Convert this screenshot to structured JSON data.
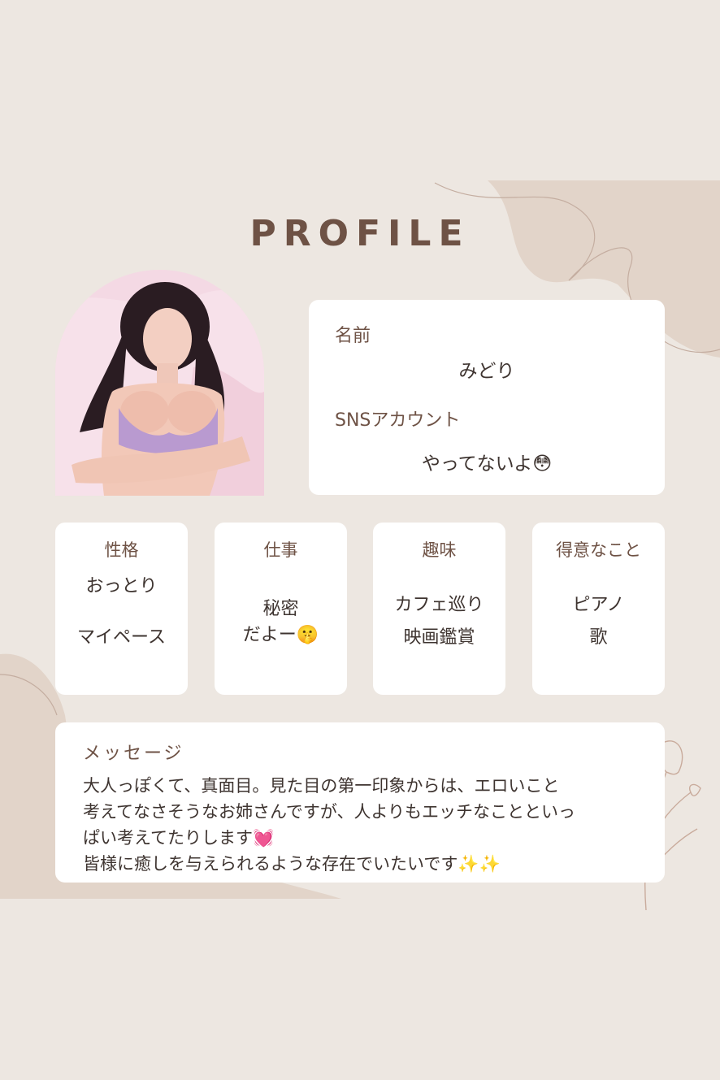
{
  "title": "PROFILE",
  "photo_alt": "profile photo",
  "main_card": {
    "name_label": "名前",
    "name_value": "みどり",
    "sns_label": "SNSアカウント",
    "sns_value": "やってないよ😳"
  },
  "cards": [
    {
      "label": "性格",
      "lines": [
        "おっとり",
        "マイペース"
      ]
    },
    {
      "label": "仕事",
      "lines": [
        "秘密",
        "だよー🤫"
      ]
    },
    {
      "label": "趣味",
      "lines": [
        "カフェ巡り",
        "映画鑑賞"
      ]
    },
    {
      "label": "得意なこと",
      "lines": [
        "ピアノ",
        "歌"
      ]
    }
  ],
  "message": {
    "label": "メッセージ",
    "lines": [
      "大人っぽくて、真面目。見た目の第一印象からは、エロいこと",
      "考えてなさそうなお姉さんですが、人よりもエッチなことといっ",
      "ぱい考えてたりします💓",
      "皆様に癒しを与えられるような存在でいたいです✨✨"
    ]
  },
  "colors": {
    "background": "#ede7e1",
    "accent": "#6e5245",
    "card": "#ffffff",
    "blob": "#e2d4c9"
  }
}
